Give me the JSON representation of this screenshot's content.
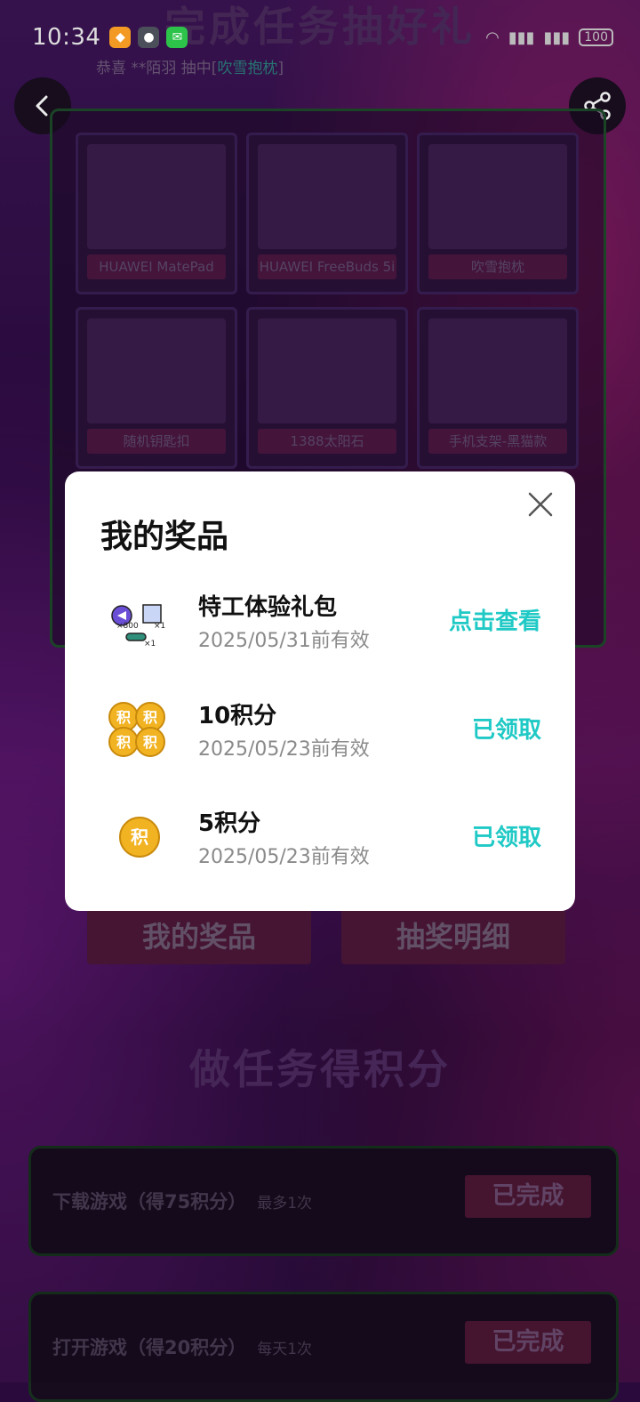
{
  "status": {
    "time": "10:34",
    "battery": "100"
  },
  "page": {
    "title": "完成任务抽好礼",
    "ticker_prefix": "恭喜 **陌羽 抽中[",
    "ticker_prize": "吹雪抱枕",
    "ticker_suffix": "]"
  },
  "prizes": [
    {
      "label": "HUAWEI MatePad"
    },
    {
      "label": "HUAWEI FreeBuds 5i"
    },
    {
      "label": "吹雪抱枕"
    },
    {
      "label": "随机钥匙扣"
    },
    {
      "label": "1388太阳石"
    },
    {
      "label": "手机支架-黑猫款"
    }
  ],
  "tabs": {
    "my_prizes": "我的奖品",
    "draw_details": "抽奖明细"
  },
  "tasks": {
    "title": "做任务得积分",
    "items": [
      {
        "name": "下载游戏（得75积分）",
        "limit": "最多1次",
        "button": "已完成"
      },
      {
        "name": "打开游戏（得20积分）",
        "limit": "每天1次",
        "button": "已完成"
      }
    ]
  },
  "modal": {
    "title": "我的奖品",
    "items": [
      {
        "name": "特工体验礼包",
        "expiry": "2025/05/31前有效",
        "action": "点击查看",
        "badge_a": "×800",
        "badge_b": "×1",
        "badge_c": "×1"
      },
      {
        "name": "10积分",
        "expiry": "2025/05/23前有效",
        "action": "已领取",
        "coin_char": "积"
      },
      {
        "name": "5积分",
        "expiry": "2025/05/23前有效",
        "action": "已领取",
        "coin_char": "积"
      }
    ]
  },
  "colors": {
    "accent": "#1fc9c5",
    "coin": "#f2b322"
  }
}
